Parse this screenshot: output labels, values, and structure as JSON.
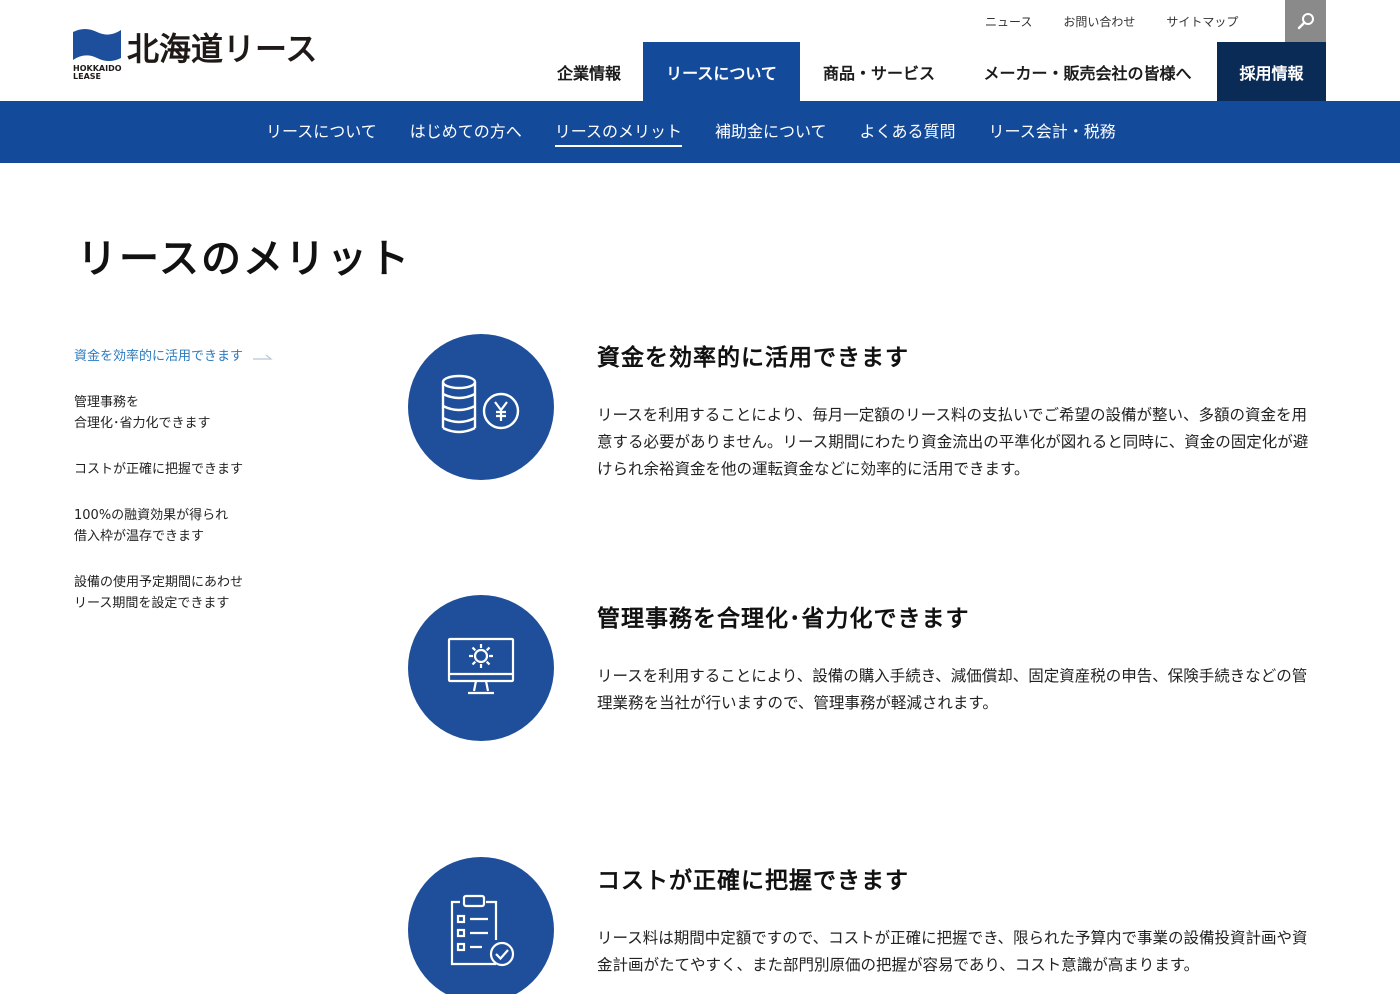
{
  "header": {
    "logo_text": "北海道リース",
    "logo_sub_1": "HOKKAIDO",
    "logo_sub_2": "LEASE",
    "util_nav": [
      "ニュース",
      "お問い合わせ",
      "サイトマップ"
    ],
    "main_nav": [
      {
        "label": "企業情報"
      },
      {
        "label": "リースについて"
      },
      {
        "label": "商品・サービス"
      },
      {
        "label": "メーカー・販売会社の皆様へ"
      },
      {
        "label": "採用情報"
      }
    ]
  },
  "subnav": [
    "リースについて",
    "はじめての方へ",
    "リースのメリット",
    "補助金について",
    "よくある質問",
    "リース会計・税務"
  ],
  "page_title": "リースのメリット",
  "side_menu": [
    "資金を効率的に活用できます",
    "管理事務を\n合理化･省力化できます",
    "コストが正確に把握できます",
    "100%の融資効果が得られ\n借入枠が温存できます",
    "設備の使用予定期間にあわせ\nリース期間を設定できます"
  ],
  "sections": [
    {
      "title": "資金を効率的に活用できます",
      "icon": "coins-yen-icon",
      "body": "リースを利用することにより、毎月一定額のリース料の支払いでご希望の設備が整い、多額の資金を用意する必要がありません。リース期間にわたり資金流出の平準化が図れると同時に、資金の固定化が避けられ余裕資金を他の運転資金などに効率的に活用できます。"
    },
    {
      "title": "管理事務を合理化･省力化できます",
      "icon": "monitor-gear-icon",
      "body": "リースを利用することにより、設備の購入手続き、減価償却、固定資産税の申告、保険手続きなどの管理業務を当社が行いますので、管理事務が軽減されます。"
    },
    {
      "title": "コストが正確に把握できます",
      "icon": "clipboard-check-icon",
      "body": "リース料は期間中定額ですので、コストが正確に把握でき、限られた予算内で事業の設備投資計画や資金計画がたてやすく、また部門別原価の把握が容易であり、コスト意識が高まります。"
    }
  ],
  "colors": {
    "brand_blue": "#144a9a",
    "dark_navy": "#0b2b57",
    "circle_blue": "#1f4f9a",
    "active_link": "#2a7bbf"
  }
}
